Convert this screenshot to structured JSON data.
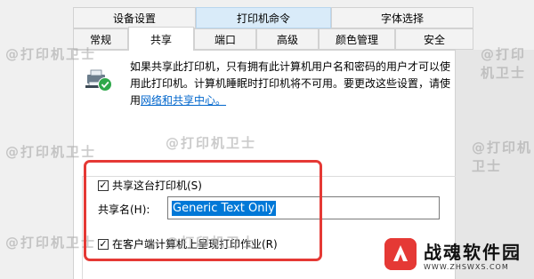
{
  "tabs_top": [
    "设备设置",
    "打印机命令",
    "字体选择"
  ],
  "tabs_bottom": [
    "常规",
    "共享",
    "端口",
    "高级",
    "颜色管理",
    "安全"
  ],
  "info_text_1": "如果共享此打印机，只有拥有此计算机用户名和密码的用户才可以使",
  "info_text_2": "用此打印机。计算机睡眠时打印机将不可用。要更改这些设置，请使",
  "info_text_3_pre": "用",
  "info_link": "网络和共享中心。",
  "share_checkbox_label": "共享这台打印机(S)",
  "share_name_label": "共享名(H):",
  "share_name_value": "Generic  Text Only",
  "render_jobs_label": "在客户端计算机上呈现打印作业(R)",
  "watermark": "@打印机卫士",
  "brand_title": "战魂软件园",
  "brand_url": "WWW.ZHSWXS.COM",
  "colors": {
    "accent": "#0078d7",
    "highlight_box": "#e53935",
    "link": "#0066cc"
  }
}
